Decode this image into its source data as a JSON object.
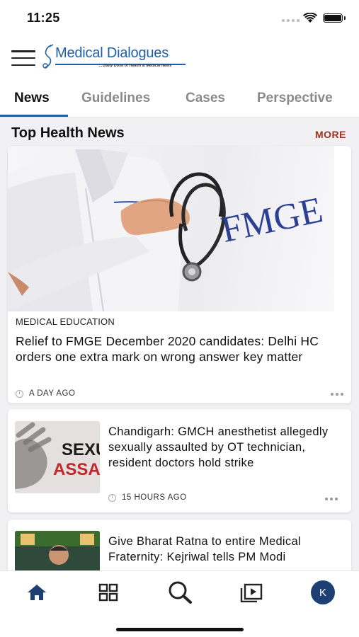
{
  "status_bar": {
    "time": "11:25"
  },
  "header": {
    "logo_title": "Medical Dialogues",
    "logo_tagline": "....Daily Dose of Health & Medical News"
  },
  "tabs": [
    {
      "label": "News",
      "active": true
    },
    {
      "label": "Guidelines",
      "active": false
    },
    {
      "label": "Cases",
      "active": false
    },
    {
      "label": "Perspective",
      "active": false
    }
  ],
  "section": {
    "title": "Top Health News",
    "more_label": "MORE"
  },
  "featured": {
    "image_text": "FMGE",
    "category": "MEDICAL EDUCATION",
    "title": "Relief to FMGE December 2020 candidates: Delhi HC orders one extra mark on wrong answer key matter",
    "time": "A DAY AGO"
  },
  "articles": [
    {
      "title": "Chandigarh: GMCH anesthetist allegedly sexually assaulted by OT technician, resident doctors hold strike",
      "time": "15 HOURS AGO",
      "image_text_1": "SEXU",
      "image_text_2": "ASSAU"
    },
    {
      "title": "Give Bharat Ratna to entire Medical Fraternity: Kejriwal tells PM Modi",
      "time": ""
    }
  ],
  "bottom_nav": {
    "items": [
      "home-icon",
      "grid-icon",
      "search-icon",
      "video-icon"
    ],
    "avatar_letter": "K"
  },
  "colors": {
    "brand_blue": "#1f5fa6",
    "more_red": "#a3301d",
    "avatar_bg": "#1d3f73"
  }
}
